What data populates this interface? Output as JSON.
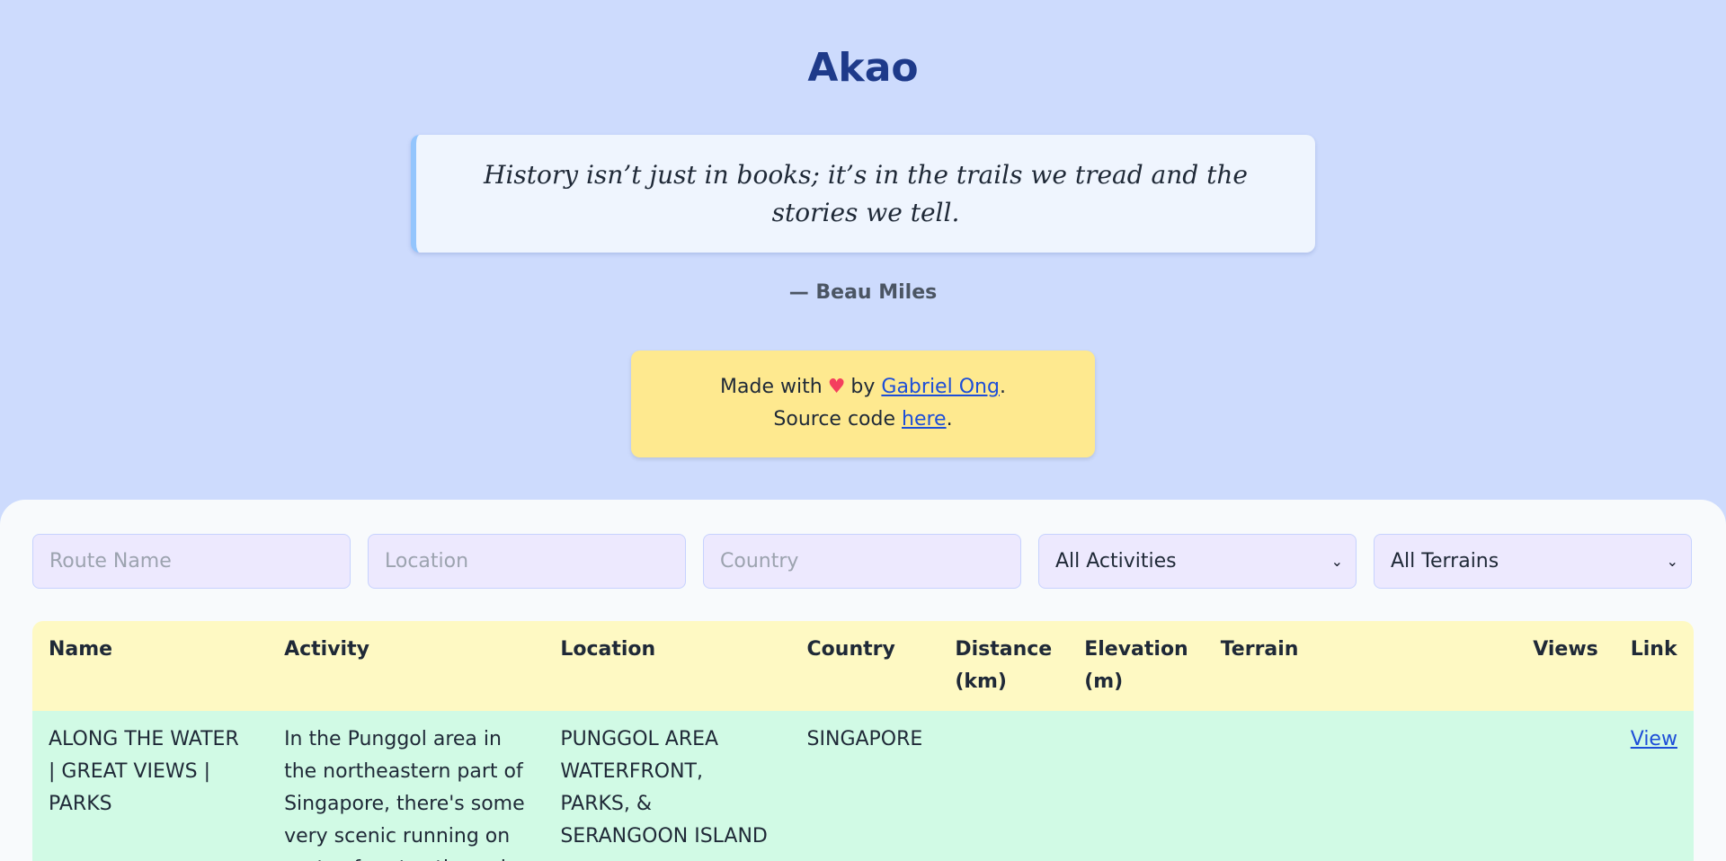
{
  "header": {
    "title": "Akao",
    "quote": "History isn’t just in books; it’s in the trails we tread and the stories we tell.",
    "author": "— Beau Miles"
  },
  "credits": {
    "made_with": "Made with",
    "heart_icon": "heart-icon",
    "by": "by",
    "author_link": "Gabriel Ong",
    "period": ".",
    "source_prefix": "Source code",
    "source_link": "here",
    "source_suffix": "."
  },
  "filters": {
    "route_name_placeholder": "Route Name",
    "location_placeholder": "Location",
    "country_placeholder": "Country",
    "activity_selected": "All Activities",
    "terrain_selected": "All Terrains"
  },
  "table": {
    "headers": {
      "name": "Name",
      "activity": "Activity",
      "location": "Location",
      "country": "Country",
      "distance": "Distance (km)",
      "elevation": "Elevation (m)",
      "terrain": "Terrain",
      "views": "Views",
      "link": "Link"
    },
    "rows": [
      {
        "name": "ALONG THE WATER | GREAT VIEWS | PARKS",
        "activity": "In the Punggol area in the northeastern part of Singapore, there's some very scenic running on parts of routes through",
        "location": "PUNGGOL AREA WATERFRONT, PARKS, & SERANGOON ISLAND",
        "country": "SINGAPORE",
        "distance": "",
        "elevation": "",
        "terrain": "",
        "views": "",
        "link": "View"
      }
    ]
  },
  "colors": {
    "background": "#cddbfd",
    "title": "#1e3a8a",
    "quote_box": "#eff5fe",
    "quote_border": "#93c5fd",
    "credits_box": "#fee98f",
    "table_header": "#fef9c3",
    "table_row": "#d1fae5",
    "filter_bg": "#ede9fe",
    "link": "#1d4ed8"
  }
}
